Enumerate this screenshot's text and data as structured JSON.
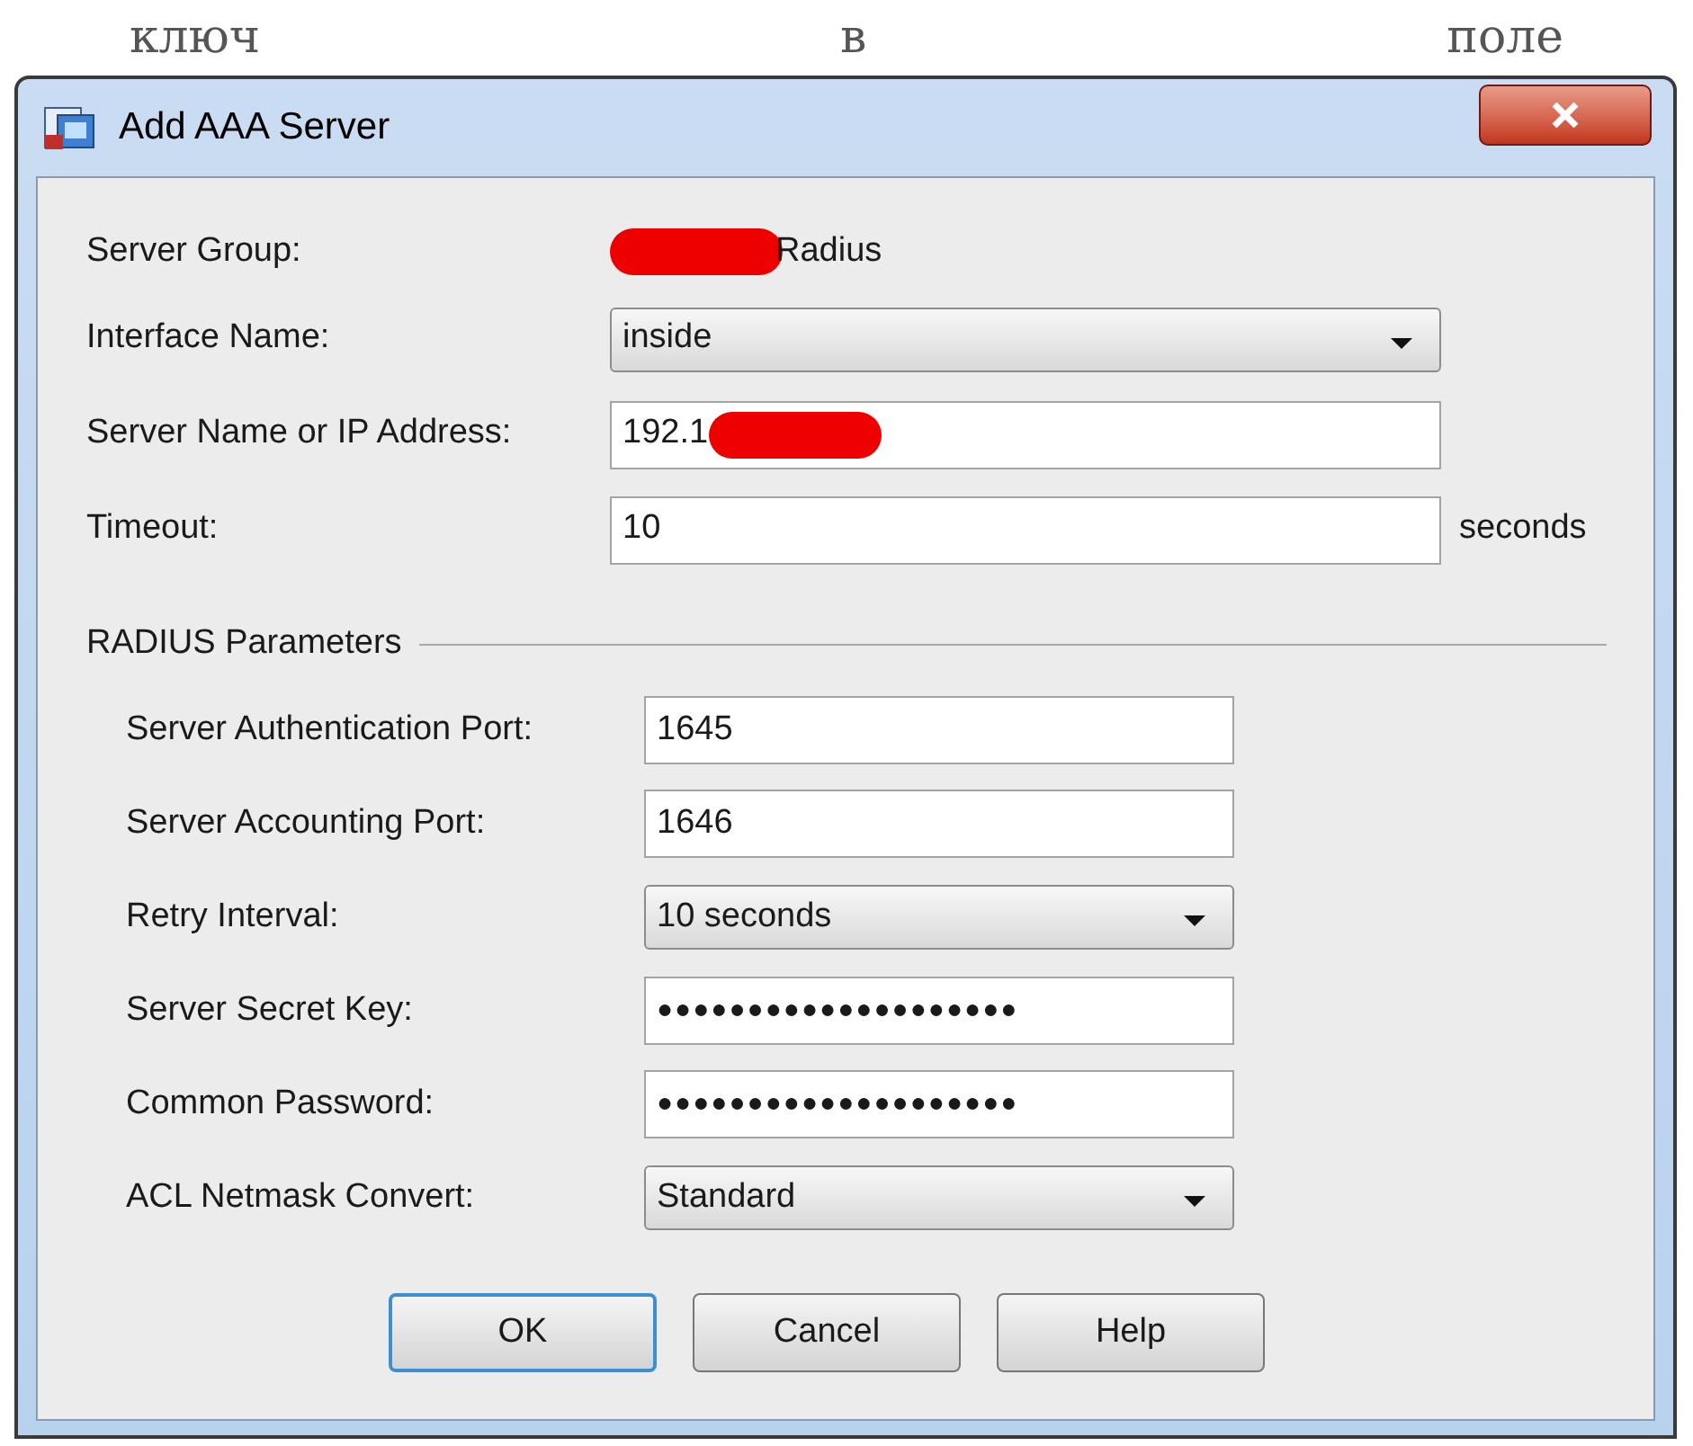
{
  "article_words": [
    "ключ",
    "в",
    "поле"
  ],
  "window": {
    "title": "Add AAA Server"
  },
  "fields": [
    {
      "kind": "static",
      "label": "Server Group:",
      "value": "Radius",
      "redacted": true
    },
    {
      "kind": "select",
      "label": "Interface Name:",
      "value": "inside"
    },
    {
      "kind": "text",
      "label": "Server Name or IP Address:",
      "value": "192.1",
      "redacted": true
    },
    {
      "kind": "text",
      "label": "Timeout:",
      "value": "10",
      "suffix": "seconds"
    }
  ],
  "radius_parameters": {
    "title": "RADIUS Parameters",
    "fields": [
      {
        "kind": "text",
        "label": "Server Authentication Port:",
        "value": "1645"
      },
      {
        "kind": "text",
        "label": "Server Accounting Port:",
        "value": "1646"
      },
      {
        "kind": "select",
        "label": "Retry Interval:",
        "value": "10 seconds"
      },
      {
        "kind": "password",
        "label": "Server Secret Key:",
        "value": "●●●●●●●●●●●●●●●●●●●●"
      },
      {
        "kind": "password",
        "label": "Common Password:",
        "value": "●●●●●●●●●●●●●●●●●●●●"
      },
      {
        "kind": "select",
        "label": "ACL Netmask Convert:",
        "value": "Standard"
      }
    ]
  },
  "buttons": [
    {
      "label": "OK",
      "default": true
    },
    {
      "label": "Cancel",
      "default": false
    },
    {
      "label": "Help",
      "default": false
    }
  ]
}
